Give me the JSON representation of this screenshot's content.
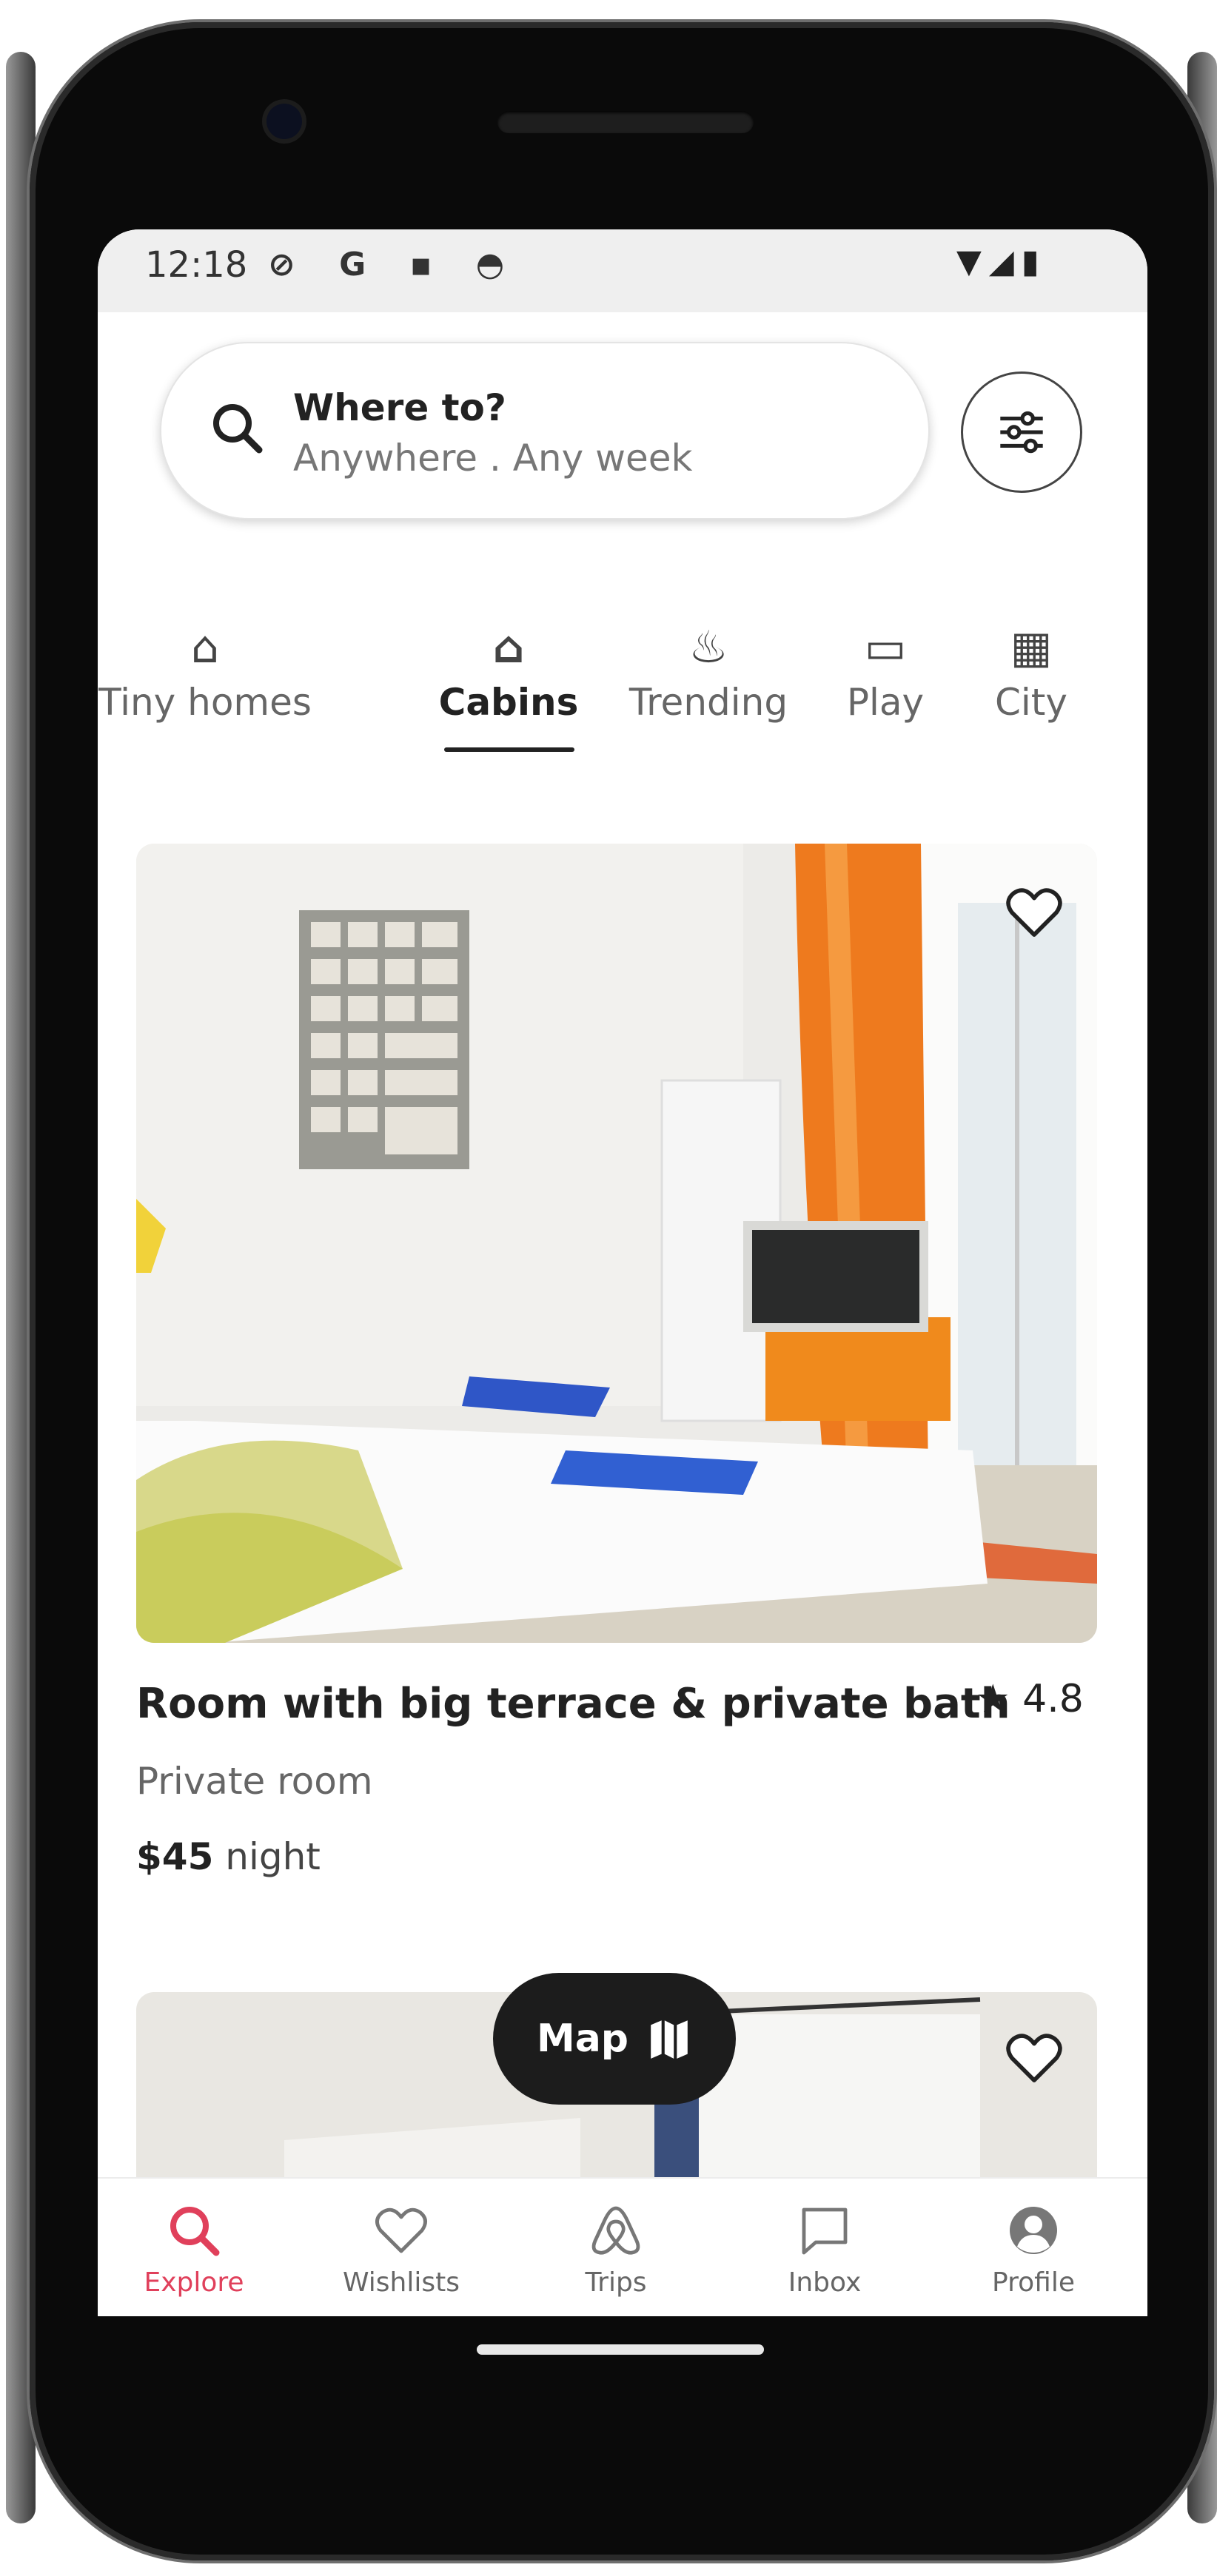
{
  "status_bar": {
    "time": "12:18",
    "left_icons": "⊘ G ▪ ◓",
    "right_icons": "▼◢▮"
  },
  "search": {
    "title": "Where to?",
    "subtitle": "Anywhere . Any week",
    "search_icon": "search-icon",
    "filter_icon": "sliders-icon"
  },
  "categories": [
    {
      "label": "Tiny homes",
      "icon": "house-icon",
      "active": false
    },
    {
      "label": "Cabins",
      "icon": "cabin-icon",
      "active": true
    },
    {
      "label": "Trending",
      "icon": "flame-icon",
      "active": false
    },
    {
      "label": "Play",
      "icon": "gamepad-icon",
      "active": false
    },
    {
      "label": "City",
      "icon": "buildings-icon",
      "active": false
    }
  ],
  "listing": {
    "title": "Room with big terrace & private bath",
    "rating": "4.8",
    "type": "Private room",
    "price": "$45",
    "price_unit": "night"
  },
  "map_button": {
    "label": "Map",
    "icon": "map-icon"
  },
  "bottom_nav": [
    {
      "label": "Explore",
      "icon": "search-icon",
      "active": true
    },
    {
      "label": "Wishlists",
      "icon": "heart-icon",
      "active": false
    },
    {
      "label": "Trips",
      "icon": "airbnb-logo-icon",
      "active": false
    },
    {
      "label": "Inbox",
      "icon": "message-icon",
      "active": false
    },
    {
      "label": "Profile",
      "icon": "profile-icon",
      "active": false
    }
  ],
  "colors": {
    "accent": "#e0405b",
    "text_primary": "#222222",
    "text_secondary": "#777777"
  }
}
